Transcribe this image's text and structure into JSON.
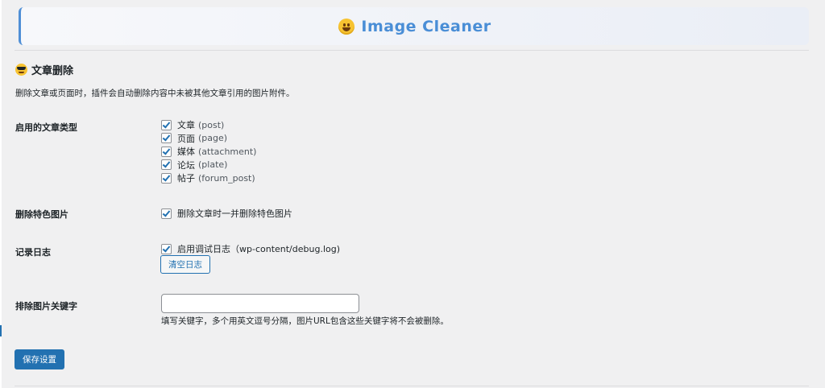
{
  "header": {
    "icon": "grinning-face-emoji",
    "title": "Image Cleaner"
  },
  "section": {
    "icon": "sunglasses-face-emoji",
    "title": "文章删除",
    "description": "删除文章或页面时，插件会自动删除内容中未被其他文章引用的图片附件。"
  },
  "post_types": {
    "label": "启用的文章类型",
    "items": [
      {
        "name": "文章",
        "slug": "(post)",
        "checked": true
      },
      {
        "name": "页面",
        "slug": "(page)",
        "checked": true
      },
      {
        "name": "媒体",
        "slug": "(attachment)",
        "checked": true
      },
      {
        "name": "论坛",
        "slug": "(plate)",
        "checked": true
      },
      {
        "name": "帖子",
        "slug": "(forum_post)",
        "checked": true
      }
    ]
  },
  "featured_image": {
    "label": "删除特色图片",
    "checkbox_label": "删除文章时一并删除特色图片",
    "checked": true
  },
  "logging": {
    "label": "记录日志",
    "checkbox_label": "启用调试日志（wp-content/debug.log)",
    "checked": true,
    "clear_button": "清空日志"
  },
  "exclude_keywords": {
    "label": "排除图片关键字",
    "value": "",
    "placeholder": "",
    "help": "填写关键字，多个用英文逗号分隔，图片URL包含这些关键字将不会被删除。"
  },
  "actions": {
    "save_label": "保存设置"
  },
  "colors": {
    "accent": "#2271b1",
    "title": "#4a8ed6",
    "background": "#f0f0f1"
  }
}
